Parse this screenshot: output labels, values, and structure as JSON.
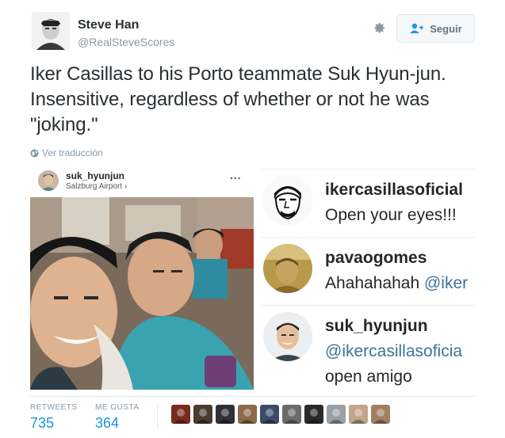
{
  "author": {
    "name": "Steve Han",
    "handle": "@RealSteveScores"
  },
  "follow_button": {
    "label": "Seguir"
  },
  "tweet": {
    "text": "Iker Casillas to his Porto teammate Suk Hyun-jun. Insensitive, regardless of whether or not he was \"joking.\"",
    "translate_label": "Ver traducción"
  },
  "instagram": {
    "post_user": "suk_hyunjun",
    "post_location": "Salzburg Airport",
    "more": "...",
    "comments": [
      {
        "user": "ikercasillasoficial",
        "text": "Open your eyes!!!",
        "avatar": "drawing-face-avatar"
      },
      {
        "user": "pavaogomes",
        "text": "Ahahahahah ",
        "mention": "@iker",
        "avatar": "photo-avatar"
      },
      {
        "user": "suk_hyunjun",
        "text": "",
        "mention": "@ikercasillasoficia",
        "text2": "open amigo",
        "avatar": "smiling-man-avatar"
      }
    ]
  },
  "stats": {
    "retweets_label": "RETWEETS",
    "retweets_value": "735",
    "likes_label": "ME GUSTA",
    "likes_value": "364",
    "liker_colors": [
      "#7a2a1f",
      "#4b3a2f",
      "#2f2f35",
      "#8c6a4a",
      "#3a4a6a",
      "#6b6b6b",
      "#2a2a2a",
      "#9aa0a6",
      "#c2a58a",
      "#a08060"
    ]
  },
  "colors": {
    "link": "#1b95e0",
    "secondary_text": "#8899a6",
    "instagram_mention": "#3f729b"
  }
}
